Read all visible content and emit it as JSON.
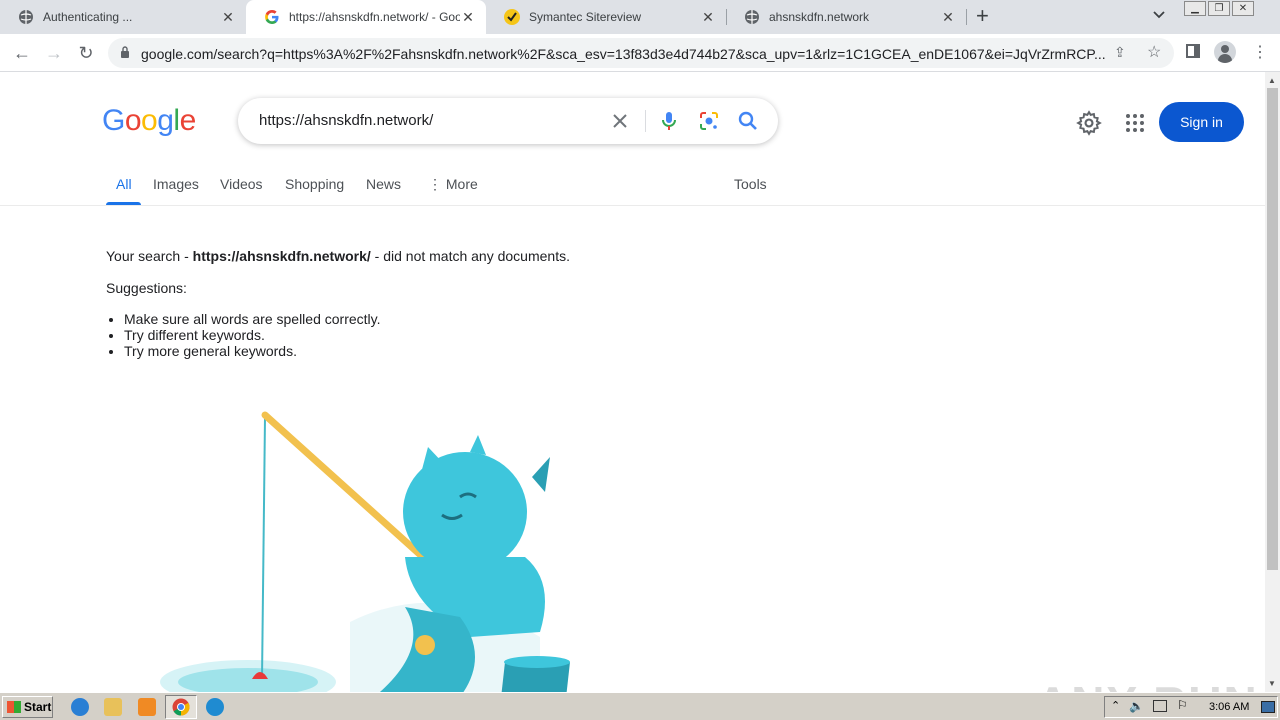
{
  "browser": {
    "tabs": [
      {
        "title": "Authenticating ...",
        "active": false
      },
      {
        "title": "https://ahsnskdfn.network/ - Google",
        "active": true
      },
      {
        "title": "Symantec Sitereview",
        "active": false
      },
      {
        "title": "ahsnskdfn.network",
        "active": false
      }
    ],
    "new_tab": "+",
    "tab_close": "✕",
    "address": "google.com/search?q=https%3A%2F%2Fahsnskdfn.network%2F&sca_esv=13f83d3e4d744b27&sca_upv=1&rlz=1C1GCEA_enDE1067&ei=JqVrZrmRCP..."
  },
  "google": {
    "logo": "Google",
    "query": "https://ahsnskdfn.network/",
    "sign_in": "Sign in",
    "nav": [
      "All",
      "Images",
      "Videos",
      "Shopping",
      "News",
      "More",
      "Tools"
    ],
    "no_result": {
      "prefix": "Your search - ",
      "term": "https://ahsnskdfn.network/",
      "suffix": " - did not match any documents."
    },
    "suggestions_label": "Suggestions:",
    "suggestions": [
      "Make sure all words are spelled correctly.",
      "Try different keywords.",
      "Try more general keywords."
    ]
  },
  "taskbar": {
    "start": "Start",
    "clock": "3:06 AM"
  },
  "watermark": "ANY RUN",
  "colors": {
    "accent": "#1a73e8",
    "signin_bg": "#0b57d0",
    "tabstrip_bg": "#dee1e6"
  }
}
